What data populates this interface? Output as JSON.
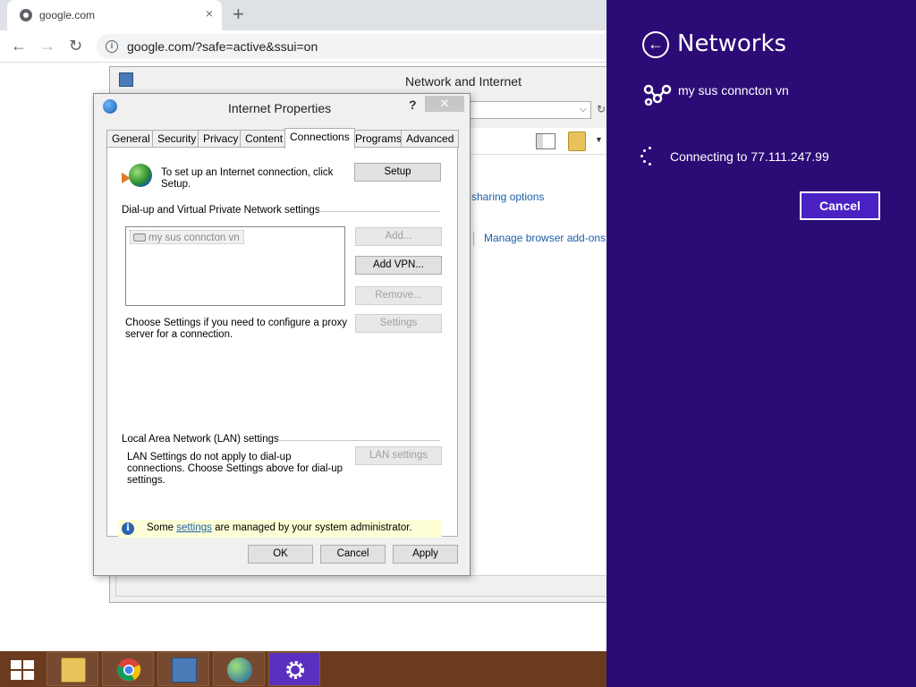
{
  "browser": {
    "tab_title": "google.com",
    "tab_close": "×",
    "new_tab": "+",
    "url": "google.com/?safe=active&ssui=on",
    "info_glyph": "i",
    "back_glyph": "←",
    "forward_glyph": "→",
    "reload_glyph": "↻"
  },
  "control_panel": {
    "title": "Network and Internet",
    "address_chevron": "⌵",
    "refresh_glyph": "↻",
    "dropdown_glyph": "▼",
    "link_sharing": "sharing options",
    "link_manage_addons": "Manage browser add-ons"
  },
  "internet_properties": {
    "title": "Internet Properties",
    "help": "?",
    "close": "✕",
    "tabs": [
      {
        "label": "General"
      },
      {
        "label": "Security"
      },
      {
        "label": "Privacy"
      },
      {
        "label": "Content"
      },
      {
        "label": "Connections",
        "active": true
      },
      {
        "label": "Programs"
      },
      {
        "label": "Advanced"
      }
    ],
    "setup_text": "To set up an Internet connection, click Setup.",
    "setup_button": "Setup",
    "vpn_group_label": "Dial-up and Virtual Private Network settings",
    "vpn_list": [
      "my sus conncton vn"
    ],
    "add_button": "Add...",
    "add_vpn_button": "Add VPN...",
    "remove_button": "Remove...",
    "settings_button": "Settings",
    "proxy_text": "Choose Settings if you need to configure a proxy server for a connection.",
    "lan_group_label": "Local Area Network (LAN) settings",
    "lan_text": "LAN Settings do not apply to dial-up connections. Choose Settings above for dial-up settings.",
    "lan_button": "LAN settings",
    "admin_icon": "i",
    "admin_text_before": "Some ",
    "admin_link": "settings",
    "admin_text_after": " are managed by your system administrator.",
    "ok_button": "OK",
    "cancel_button": "Cancel",
    "apply_button": "Apply"
  },
  "networks_panel": {
    "back_glyph": "←",
    "title": "Networks",
    "connection_name": "my sus conncton vn",
    "status": "Connecting to 77.111.247.99",
    "cancel_button": "Cancel"
  },
  "taskbar": {
    "items": [
      {
        "name": "file-explorer"
      },
      {
        "name": "chrome"
      },
      {
        "name": "control-panel"
      },
      {
        "name": "internet-options"
      },
      {
        "name": "settings"
      }
    ]
  },
  "colors": {
    "charm_background": "#2b0c76",
    "charm_button": "#4a22c4",
    "taskbar": "#6b3b1f",
    "link": "#1b5fa8"
  }
}
